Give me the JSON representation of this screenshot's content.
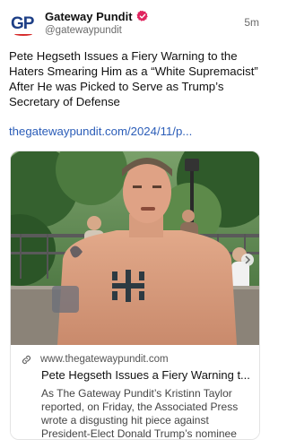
{
  "post": {
    "author_name": "Gateway Pundit",
    "author_handle": "@gatewaypundit",
    "avatar_text": "GP",
    "timestamp": "5m",
    "text": "Pete Hegseth Issues a Fiery Warning to the Haters Smearing Him as a “White Supremacist” After He was Picked to Serve as Trump’s Secretary of Defense",
    "link_text": "thegatewaypundit.com/2024/11/p..."
  },
  "card": {
    "domain": "www.thegatewaypundit.com",
    "title": "Pete Hegseth Issues a Fiery Warning t...",
    "description": "As The Gateway Pundit’s Kristinn Taylor reported, on Friday, the Associated Press wrote a disgusting hit piece against President-Elect Donald Trump’s nominee for...",
    "image_alt": "Photo of a shirtless man with tattoos in a park"
  },
  "colors": {
    "link": "#2b5db8",
    "verified_badge": "#e0245e",
    "brand_blue": "#1d3f86",
    "brand_red": "#d62c2c"
  },
  "icons": {
    "verified": "verified-badge-icon",
    "link": "link-icon"
  }
}
